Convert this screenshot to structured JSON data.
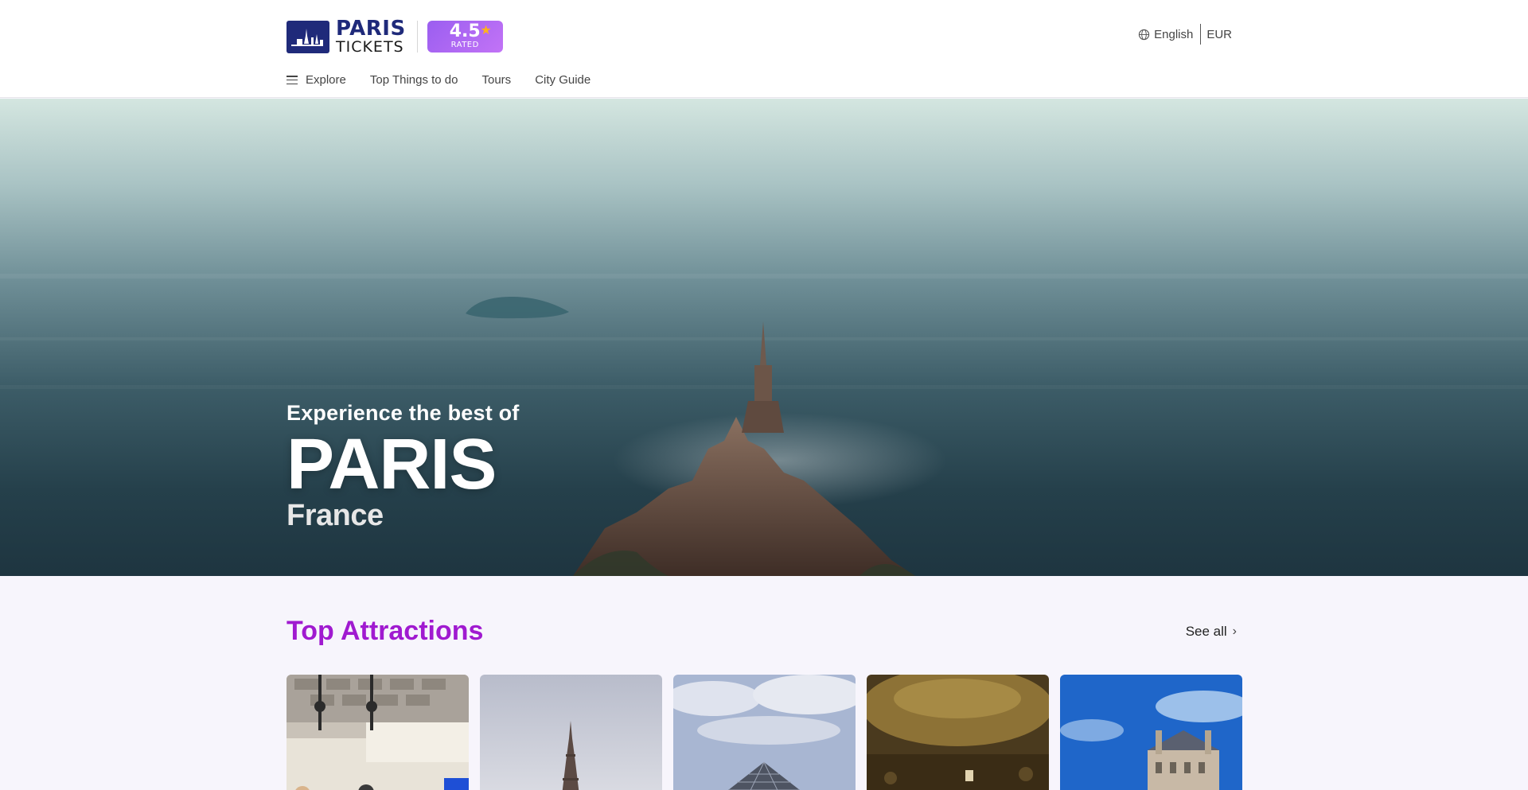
{
  "header": {
    "brand_line1": "PARIS",
    "brand_line2": "TICKETS",
    "rating_score": "4.5",
    "rating_label": "RATED",
    "language": "English",
    "currency": "EUR"
  },
  "nav": {
    "explore": "Explore",
    "items": [
      "Top Things to do",
      "Tours",
      "City Guide"
    ]
  },
  "hero": {
    "pre": "Experience the best of",
    "city": "PARIS",
    "country": "France"
  },
  "attractions": {
    "title": "Top Attractions",
    "see_all": "See all"
  },
  "colors": {
    "brand_navy": "#1f2a7a",
    "accent_purple": "#a01ad0",
    "rating_purple": "#b06af3"
  }
}
